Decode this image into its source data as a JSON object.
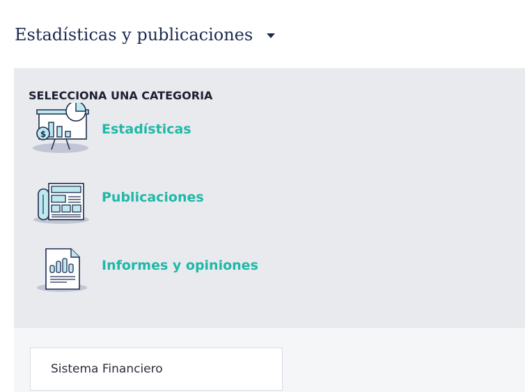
{
  "header": {
    "title": "Estadísticas y publicaciones",
    "toggle_icon": "caret-down-icon"
  },
  "panel": {
    "section_label": "SELECCIONA UNA CATEGORIA",
    "categories": [
      {
        "label": "Estadísticas",
        "icon": "presentation-chart-icon"
      },
      {
        "label": "Publicaciones",
        "icon": "newspaper-icon"
      },
      {
        "label": "Informes y opiniones",
        "icon": "report-document-icon"
      }
    ]
  },
  "filter": {
    "selected": "Sistema Financiero"
  },
  "colors": {
    "title": "#1b2a4e",
    "accent": "#1fb8a7",
    "panel_bg": "#e9eaee",
    "section_label": "#1c2033"
  }
}
